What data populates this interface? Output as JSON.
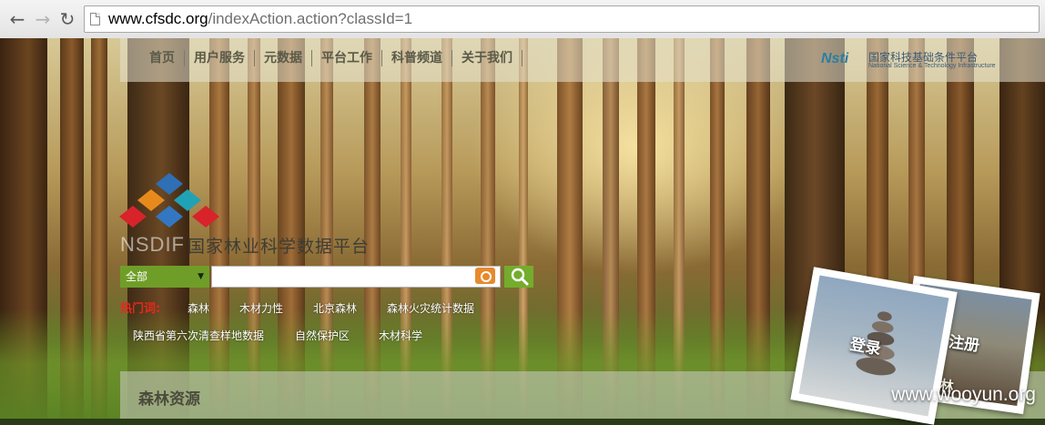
{
  "browser": {
    "url_host": "www.cfsdc.org",
    "url_path": "/indexAction.action?classId=1"
  },
  "topnav": {
    "items": [
      "首页",
      "用户服务",
      "元数据",
      "平台工作",
      "科普频道",
      "关于我们"
    ],
    "partner_logo": {
      "mark": "Nsti",
      "name": "国家科技基础条件平台",
      "subtitle": "National Science & Technology Infrastructure"
    }
  },
  "logo": {
    "acronym": "NSDIF",
    "name": "国家林业科学数据平台"
  },
  "search": {
    "category": "全部",
    "value": ""
  },
  "hot_words": {
    "label": "热门词:",
    "words": [
      "森林",
      "木材力性",
      "北京森林",
      "森林火灾统计数据",
      "陕西省第六次清查样地数据",
      "自然保护区",
      "木材科学"
    ]
  },
  "section": {
    "title": "森林资源"
  },
  "cards": {
    "login": "登录",
    "register": "注册",
    "register_under": "森林"
  },
  "watermark": "www.wooyun.org",
  "colors": {
    "search_category_bg": "#6f9e28",
    "search_button_bg": "#74ac2d",
    "hot_label": "#e6291f"
  }
}
